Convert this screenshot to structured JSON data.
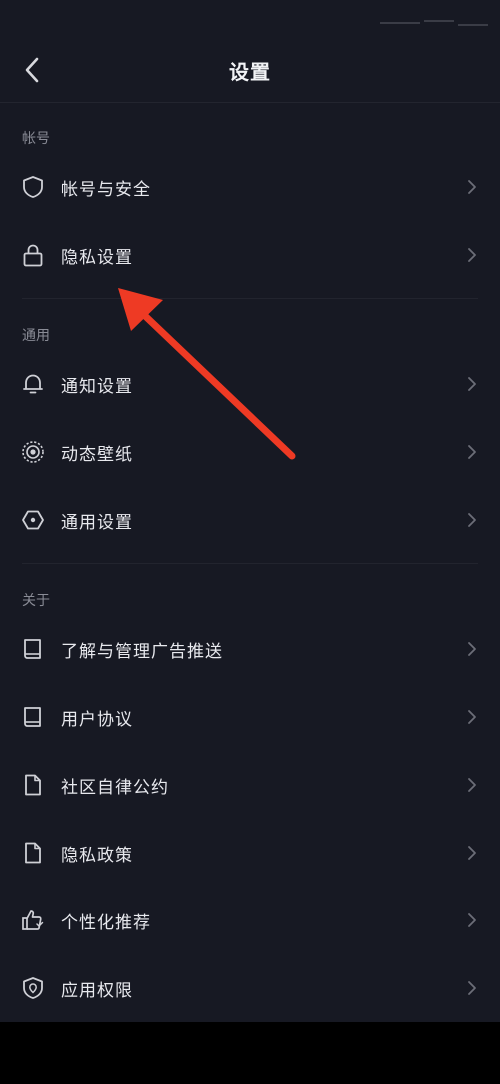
{
  "header": {
    "title": "设置"
  },
  "sections": {
    "account": {
      "label": "帐号",
      "items": [
        {
          "label": "帐号与安全",
          "icon": "shield-icon"
        },
        {
          "label": "隐私设置",
          "icon": "lock-icon"
        }
      ]
    },
    "general": {
      "label": "通用",
      "items": [
        {
          "label": "通知设置",
          "icon": "bell-icon"
        },
        {
          "label": "动态壁纸",
          "icon": "wallpaper-icon"
        },
        {
          "label": "通用设置",
          "icon": "hexagon-settings-icon"
        }
      ]
    },
    "about": {
      "label": "关于",
      "items": [
        {
          "label": "了解与管理广告推送",
          "icon": "book-icon"
        },
        {
          "label": "用户协议",
          "icon": "book-icon"
        },
        {
          "label": "社区自律公约",
          "icon": "document-icon"
        },
        {
          "label": "隐私政策",
          "icon": "document-icon"
        },
        {
          "label": "个性化推荐",
          "icon": "thumbs-up-icon"
        },
        {
          "label": "应用权限",
          "icon": "shield-location-icon"
        }
      ]
    }
  },
  "colors": {
    "background": "#171923",
    "text": "#e8e9ee",
    "muted": "#8a8c96",
    "annotation_arrow": "#ee3a24"
  }
}
